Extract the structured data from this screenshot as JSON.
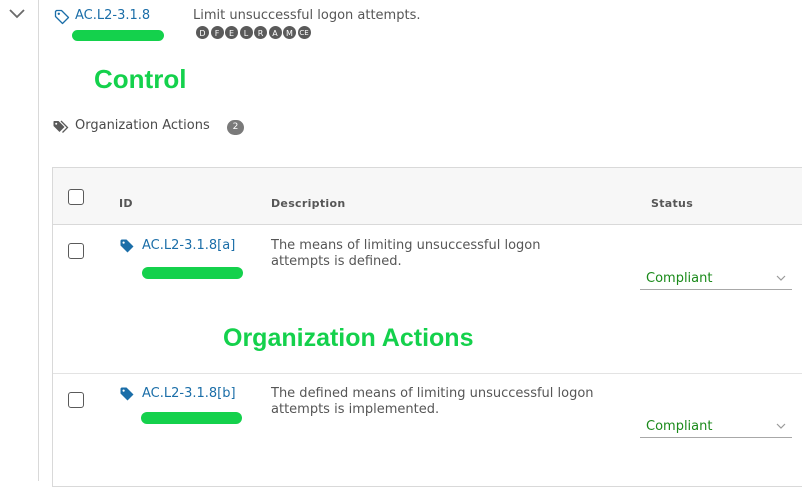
{
  "control": {
    "id": "AC.L2-3.1.8",
    "title": "Limit unsuccessful logon attempts.",
    "badges": [
      "D",
      "F",
      "E",
      "L",
      "R",
      "A",
      "M",
      "CE"
    ]
  },
  "annotations": {
    "control": "Control",
    "org_actions": "Organization Actions"
  },
  "org_actions": {
    "label": "Organization Actions",
    "count": "2"
  },
  "table": {
    "columns": {
      "id": "ID",
      "description": "Description",
      "status": "Status"
    },
    "rows": [
      {
        "id": "AC.L2-3.1.8[a]",
        "description": "The means of limiting unsuccessful logon attempts is defined.",
        "status": "Compliant"
      },
      {
        "id": "AC.L2-3.1.8[b]",
        "description": "The defined means of limiting unsuccessful logon attempts is implemented.",
        "status": "Compliant"
      }
    ]
  },
  "colors": {
    "link": "#1b6ea8",
    "annotation_green": "#14d14c",
    "status_green": "#1a8a1a",
    "badge_gray": "#5a5a5a"
  },
  "icons": [
    "chevron-down-icon",
    "tag-outline-icon",
    "tags-icon",
    "tag-solid-icon",
    "caret-down-icon"
  ]
}
